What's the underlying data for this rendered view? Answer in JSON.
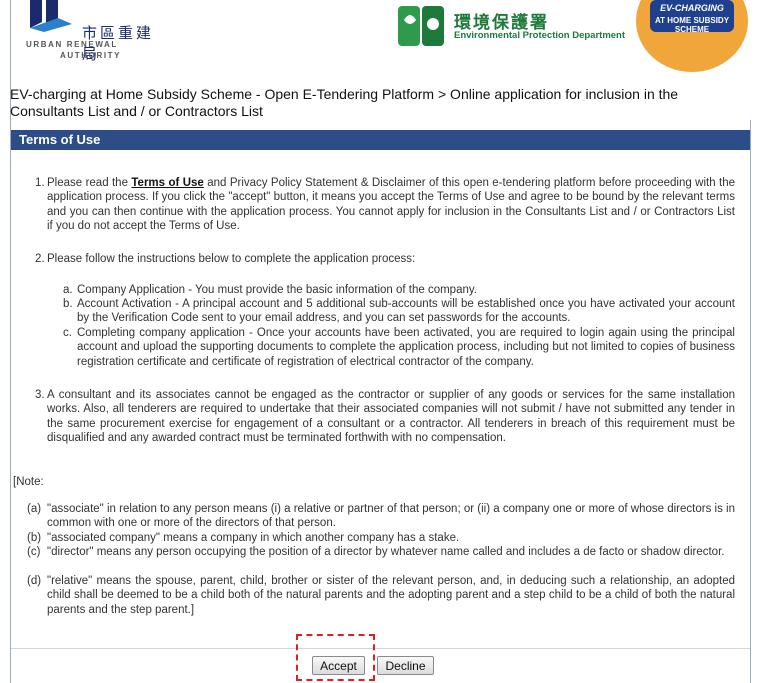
{
  "header": {
    "ura_logo": {
      "chinese": "市區重建局",
      "english_line1": "URBAN RENEWAL",
      "english_line2": "AUTHORITY"
    },
    "epd_logo": {
      "chinese": "環境保護署",
      "english": "Environmental Protection Department"
    },
    "ev_badge": {
      "line1": "EV-CHARGING",
      "line2": "AT HOME SUBSIDY SCHEME"
    }
  },
  "breadcrumb": "EV-charging at Home Subsidy Scheme - Open E-Tendering Platform > Online application for inclusion in the Consultants List and / or Contractors List",
  "section": {
    "title": "Terms of Use"
  },
  "points": {
    "p1_num": "1.",
    "p1_before": "Please read the ",
    "p1_link": "Terms of Use",
    "p1_after": " and Privacy Policy Statement & Disclaimer of this open e-tendering platform before proceeding with the application process. If you click the \"accept\" button, it means you accept the Terms of Use and agree to be bound by the relevant terms and you can then continue with the application process. You cannot apply for inclusion in the Consultants List and / or Contractors List if you do not accept the Terms of Use.",
    "p2_num": "2.",
    "p2": "Please follow the instructions below to complete the application process:",
    "sub_a_num": "a.",
    "sub_a": "Company Application - You must provide the basic information of the company.",
    "sub_b_num": "b.",
    "sub_b": "Account Activation - A principal account and 5 additional sub-accounts will be established once you have activated your account by the Verification Code sent to your email address, and you can set passwords for the accounts.",
    "sub_c_num": "c.",
    "sub_c": "Completing company application - Once your accounts have been activated, you are required to login again using the principal account and upload the supporting documents to complete the application process, including but not limited to copies of business registration certificate and certificate of registration of electrical contractor of the company.",
    "p3_num": "3.",
    "p3": "A consultant and its associates cannot be engaged as the contractor or supplier of any goods or services for the same installation works. Also, all tenderers are required to undertake that their associated companies will not submit / have not submitted any tender in the same procurement exercise for engagement of a consultant or a contractor. All tenderers in breach of this requirement must be disqualified and any awarded contract must be terminated forthwith with no compensation."
  },
  "note": {
    "heading": "[Note:",
    "a_num": "(a)",
    "a": "\"associate\" in relation to any person means (i) a relative or partner of that person; or (ii) a company one or more of whose directors is in common with one or more of the directors of that person.",
    "b_num": "(b)",
    "b": "\"associated company\" means a company in which another company has a stake.",
    "c_num": "(c)",
    "c": "\"director\" means any person occupying the position of a director by whatever name called and includes a de facto or shadow director.",
    "d_num": "(d)",
    "d": "\"relative\" means the spouse, parent, child, brother or sister of the relevant person, and, in deducing such a relationship, an adopted child shall be deemed to be a child both of the natural parents and the adopting parent and a step child to be a child of both the natural parents and the step parent.]"
  },
  "buttons": {
    "accept": "Accept",
    "decline": "Decline"
  },
  "colors": {
    "section_bar": "#2d4d88",
    "highlight": "#e02020",
    "epd_green": "#1e7a3a",
    "badge_orange": "#f0a63a"
  }
}
